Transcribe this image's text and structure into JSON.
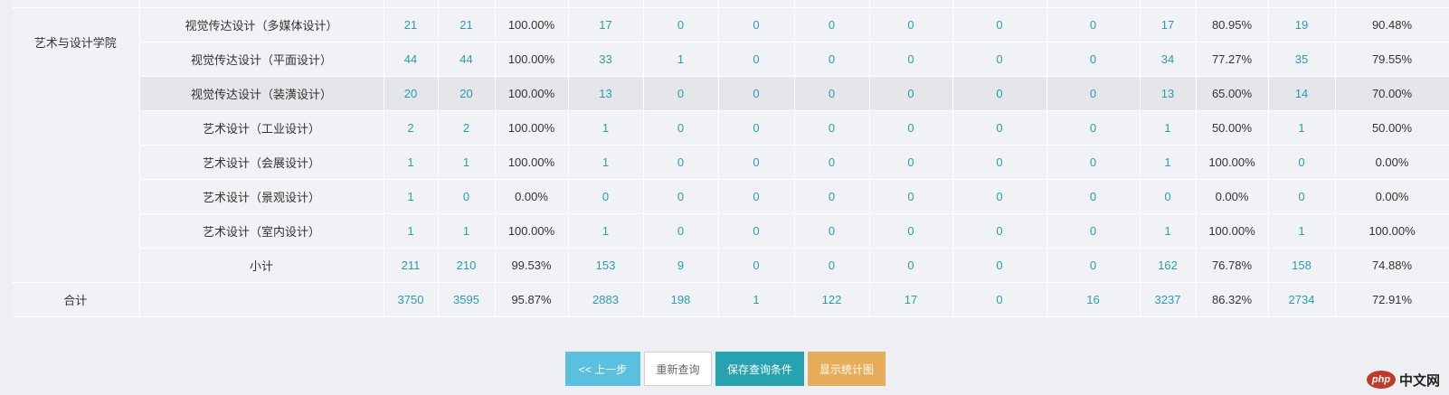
{
  "college_name": "艺术与设计学院",
  "rows": [
    {
      "major": "视觉传达设计（多媒体设计）",
      "c1": "21",
      "c2": "21",
      "c3": "100.00%",
      "c4": "17",
      "c5": "0",
      "c6": "0",
      "c7": "0",
      "c8": "0",
      "c9": "0",
      "c10": "0",
      "c11": "17",
      "c12": "80.95%",
      "c13": "19",
      "c14": "90.48%"
    },
    {
      "major": "视觉传达设计（平面设计）",
      "c1": "44",
      "c2": "44",
      "c3": "100.00%",
      "c4": "33",
      "c5": "1",
      "c6": "0",
      "c7": "0",
      "c8": "0",
      "c9": "0",
      "c10": "0",
      "c11": "34",
      "c12": "77.27%",
      "c13": "35",
      "c14": "79.55%"
    },
    {
      "major": "视觉传达设计（装潢设计）",
      "c1": "20",
      "c2": "20",
      "c3": "100.00%",
      "c4": "13",
      "c5": "0",
      "c6": "0",
      "c7": "0",
      "c8": "0",
      "c9": "0",
      "c10": "0",
      "c11": "13",
      "c12": "65.00%",
      "c13": "14",
      "c14": "70.00%"
    },
    {
      "major": "艺术设计（工业设计）",
      "c1": "2",
      "c2": "2",
      "c3": "100.00%",
      "c4": "1",
      "c5": "0",
      "c6": "0",
      "c7": "0",
      "c8": "0",
      "c9": "0",
      "c10": "0",
      "c11": "1",
      "c12": "50.00%",
      "c13": "1",
      "c14": "50.00%"
    },
    {
      "major": "艺术设计（会展设计）",
      "c1": "1",
      "c2": "1",
      "c3": "100.00%",
      "c4": "1",
      "c5": "0",
      "c6": "0",
      "c7": "0",
      "c8": "0",
      "c9": "0",
      "c10": "0",
      "c11": "1",
      "c12": "100.00%",
      "c13": "0",
      "c14": "0.00%"
    },
    {
      "major": "艺术设计（景观设计）",
      "c1": "1",
      "c2": "0",
      "c3": "0.00%",
      "c4": "0",
      "c5": "0",
      "c6": "0",
      "c7": "0",
      "c8": "0",
      "c9": "0",
      "c10": "0",
      "c11": "0",
      "c12": "0.00%",
      "c13": "0",
      "c14": "0.00%"
    },
    {
      "major": "艺术设计（室内设计）",
      "c1": "1",
      "c2": "1",
      "c3": "100.00%",
      "c4": "1",
      "c5": "0",
      "c6": "0",
      "c7": "0",
      "c8": "0",
      "c9": "0",
      "c10": "0",
      "c11": "1",
      "c12": "100.00%",
      "c13": "1",
      "c14": "100.00%"
    },
    {
      "major": "小计",
      "c1": "211",
      "c2": "210",
      "c3": "99.53%",
      "c4": "153",
      "c5": "9",
      "c6": "0",
      "c7": "0",
      "c8": "0",
      "c9": "0",
      "c10": "0",
      "c11": "162",
      "c12": "76.78%",
      "c13": "158",
      "c14": "74.88%"
    }
  ],
  "total": {
    "label": "合计",
    "major": "",
    "c1": "3750",
    "c2": "3595",
    "c3": "95.87%",
    "c4": "2883",
    "c5": "198",
    "c6": "1",
    "c7": "122",
    "c8": "17",
    "c9": "0",
    "c10": "16",
    "c11": "3237",
    "c12": "86.32%",
    "c13": "2734",
    "c14": "72.91%"
  },
  "buttons": {
    "prev": "<< 上一步",
    "reset": "重新查询",
    "save": "保存查询条件",
    "chart": "显示统计图"
  },
  "logo": {
    "badge": "php",
    "text": "中文网"
  },
  "colors": {
    "link": "#2a9cb0",
    "prev_btn": "#5bc0de",
    "save_btn": "#26a2b0",
    "chart_btn": "#e8ad5a"
  }
}
